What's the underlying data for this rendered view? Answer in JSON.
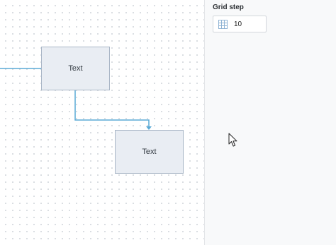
{
  "canvas": {
    "nodes": [
      {
        "label": "Text"
      },
      {
        "label": "Text"
      }
    ],
    "colors": {
      "connector": "#5aaad6",
      "node_fill": "#e9edf3",
      "node_border": "#a9b6c6"
    }
  },
  "panel": {
    "grid_step": {
      "title": "Grid step",
      "value": "10",
      "icon": "grid-icon"
    }
  },
  "cursor": {
    "icon": "mouse-pointer-icon"
  }
}
